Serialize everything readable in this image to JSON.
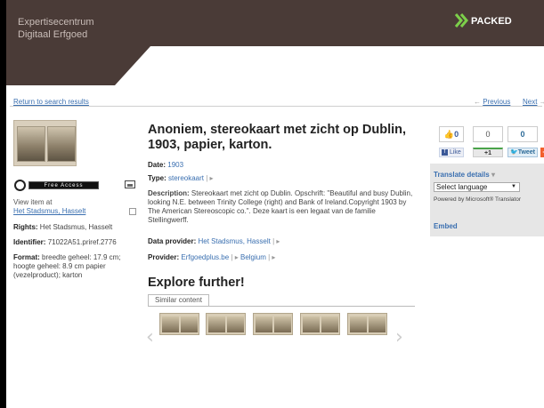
{
  "header": {
    "brand_line1": "Expertisecentrum",
    "brand_line2": "Digitaal  Erfgoed",
    "partner": "PACKED"
  },
  "nav": {
    "return": "Return to search results",
    "previous": "Previous",
    "next": "Next"
  },
  "left": {
    "free_access": "Free Access",
    "view_item_at": "View item at",
    "view_item_link": "Het Stadsmus, Hasselt",
    "rights_label": "Rights:",
    "rights_value": "Het Stadsmus, Hasselt",
    "identifier_label": "Identifier:",
    "identifier_value": "71022A51.priref.2776",
    "format_label": "Format:",
    "format_value": "breedte geheel: 17.9 cm; hoogte geheel: 8.9 cm  papier (vezelproduct); karton"
  },
  "main": {
    "title": "Anoniem, stereokaart met zicht op Dublin, 1903, papier, karton.",
    "date_label": "Date:",
    "date_value": "1903",
    "type_label": "Type:",
    "type_value": "stereokaart",
    "description_label": "Description:",
    "description_value": "Stereokaart met zicht op Dublin. Opschrift: \"Beautiful and busy Dublin, looking N.E. between Trinity College (right) and Bank of Ireland.Copyright 1903 by The American Stereoscopic co.\". Deze kaart is een legaat van de familie Stellingwerff.",
    "data_provider_label": "Data provider:",
    "data_provider_value": "Het Stadsmus, Hasselt",
    "provider_label": "Provider:",
    "provider_value": "Erfgoedplus.be",
    "provider_country": "Belgium",
    "explore": "Explore further!",
    "similar_tab": "Similar content"
  },
  "social": {
    "like_count": "0",
    "gplus_count": "0",
    "tweet_count": "0",
    "like_label": "Like",
    "gplus_label": "+1",
    "tweet_label": "Tweet",
    "plus_label": "+"
  },
  "translate": {
    "details": "Translate details",
    "select": "Select language",
    "powered": "Powered by Microsoft® Translator",
    "embed": "Embed"
  }
}
